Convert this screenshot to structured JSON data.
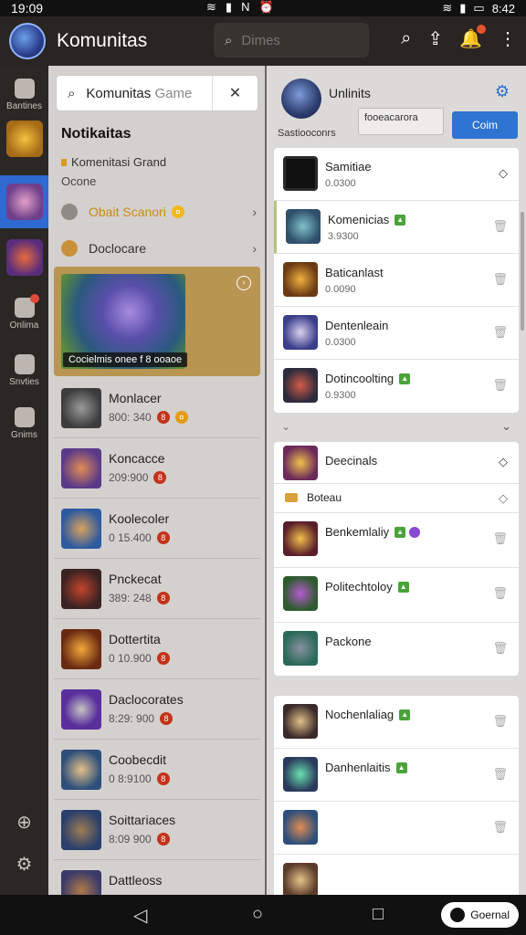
{
  "status": {
    "time": "19:09",
    "time_right": "8:42"
  },
  "header": {
    "title": "Komunitas",
    "search_placeholder": "Dimes"
  },
  "rail": [
    {
      "label": "Bantines",
      "icon": "chat-icon"
    },
    {
      "label": "Onlima",
      "icon": "bag-icon"
    },
    {
      "label": "Snvties",
      "icon": "calendar-icon"
    },
    {
      "label": "Gnims",
      "icon": "home-icon"
    }
  ],
  "left": {
    "search_value": "Komunitas",
    "search_suffix": "Game",
    "section_title": "Notikaitas",
    "sub1": "Komenitasi Grand",
    "sub2": "Ocone",
    "rows": [
      {
        "label": "Obait Scanori"
      },
      {
        "label": "Doclocare"
      }
    ],
    "featured_caption": "Cocielmis onee f 8 ooaoe",
    "games": [
      {
        "name": "Monlacer",
        "meta": "800: 340",
        "badge": "8"
      },
      {
        "name": "Koncacce",
        "meta": "209:900",
        "badge": "8"
      },
      {
        "name": "Koolecoler",
        "meta": "0 15.400",
        "badge": "8"
      },
      {
        "name": "Pnckecat",
        "meta": "389: 248",
        "badge": "8"
      },
      {
        "name": "Dottertita",
        "meta": "0 10.900",
        "badge": "8"
      },
      {
        "name": "Daclocorates",
        "meta": "8:29: 900",
        "badge": "8"
      },
      {
        "name": "Coobecdit",
        "meta": "0 8:9100",
        "badge": "8"
      },
      {
        "name": "Soittariaces",
        "meta": "8:09 900",
        "badge": "8"
      },
      {
        "name": "Dattleoss",
        "meta": "",
        "badge": ""
      }
    ]
  },
  "right": {
    "title": "Unlinits",
    "field_text": "fooeacarora",
    "button_label": "Coim",
    "subtitle": "Sastiooconrs",
    "card1": [
      {
        "name": "Samitiae",
        "meta": "0.0300",
        "icon": "diamond-icon"
      },
      {
        "name": "Komenicias",
        "meta": "3.9300",
        "icon": "trash-icon",
        "green": true
      },
      {
        "name": "Baticanlast",
        "meta": "0.0090",
        "icon": "trash-icon"
      },
      {
        "name": "Dentenleain",
        "meta": "0.0300",
        "icon": "trash-icon"
      },
      {
        "name": "Dotincoolting",
        "meta": "0.9300",
        "icon": "trash-icon",
        "green": true
      }
    ],
    "card2": [
      {
        "name": "Deecinals",
        "icon": "diamond-icon"
      },
      {
        "name": "Boteau",
        "short": true,
        "icon": "diamond-icon"
      },
      {
        "name": "Benkemlaliy",
        "icon": "trash-icon",
        "purple": true
      },
      {
        "name": "Politechtoloy",
        "icon": "trash-icon",
        "green": true
      },
      {
        "name": "Packone",
        "icon": "trash-icon"
      }
    ],
    "card3": [
      {
        "name": "Nochenlaliag",
        "icon": "trash-icon",
        "green": true
      },
      {
        "name": "Danhenlaitis",
        "icon": "trash-icon",
        "green": true
      },
      {
        "name": "",
        "icon": "trash-icon"
      },
      {
        "name": "",
        "icon": ""
      }
    ]
  },
  "navbar": {
    "pill_label": "Goernal"
  }
}
